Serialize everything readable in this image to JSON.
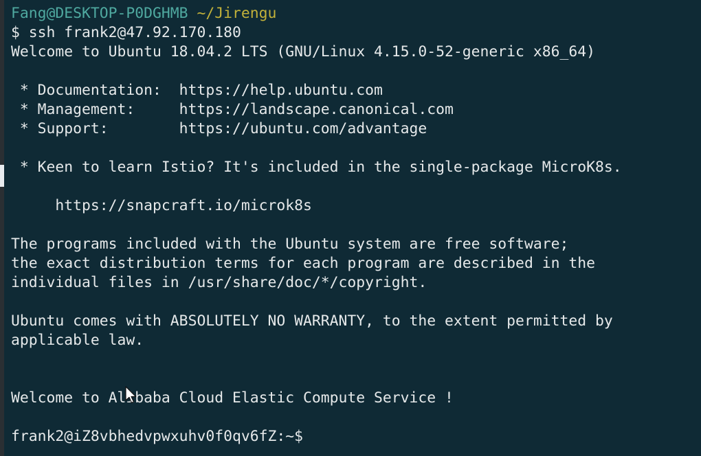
{
  "terminal": {
    "prompt_user_host": "Fang@DESKTOP-P0DGHMB",
    "prompt_path": "~/Jirengu",
    "lines": [
      "$ ssh frank2@47.92.170.180",
      "Welcome to Ubuntu 18.04.2 LTS (GNU/Linux 4.15.0-52-generic x86_64)",
      " * Documentation:  https://help.ubuntu.com",
      " * Management:     https://landscape.canonical.com",
      " * Support:        https://ubuntu.com/advantage",
      " * Keen to learn Istio? It's included in the single-package MicroK8s.",
      "     https://snapcraft.io/microk8s",
      "The programs included with the Ubuntu system are free software;",
      "the exact distribution terms for each program are described in the",
      "individual files in /usr/share/doc/*/copyright.",
      "Ubuntu comes with ABSOLUTELY NO WARRANTY, to the extent permitted by",
      "applicable law.",
      "Welcome to Alibaba Cloud Elastic Compute Service !",
      "frank2@iZ8vbhedvpwxuhv0f0qv6fZ:~$"
    ]
  },
  "colors": {
    "background": "#0f2a35",
    "text": "#e6e9ea",
    "prompt_user": "#4fa9a0",
    "prompt_path": "#c2b13a"
  }
}
